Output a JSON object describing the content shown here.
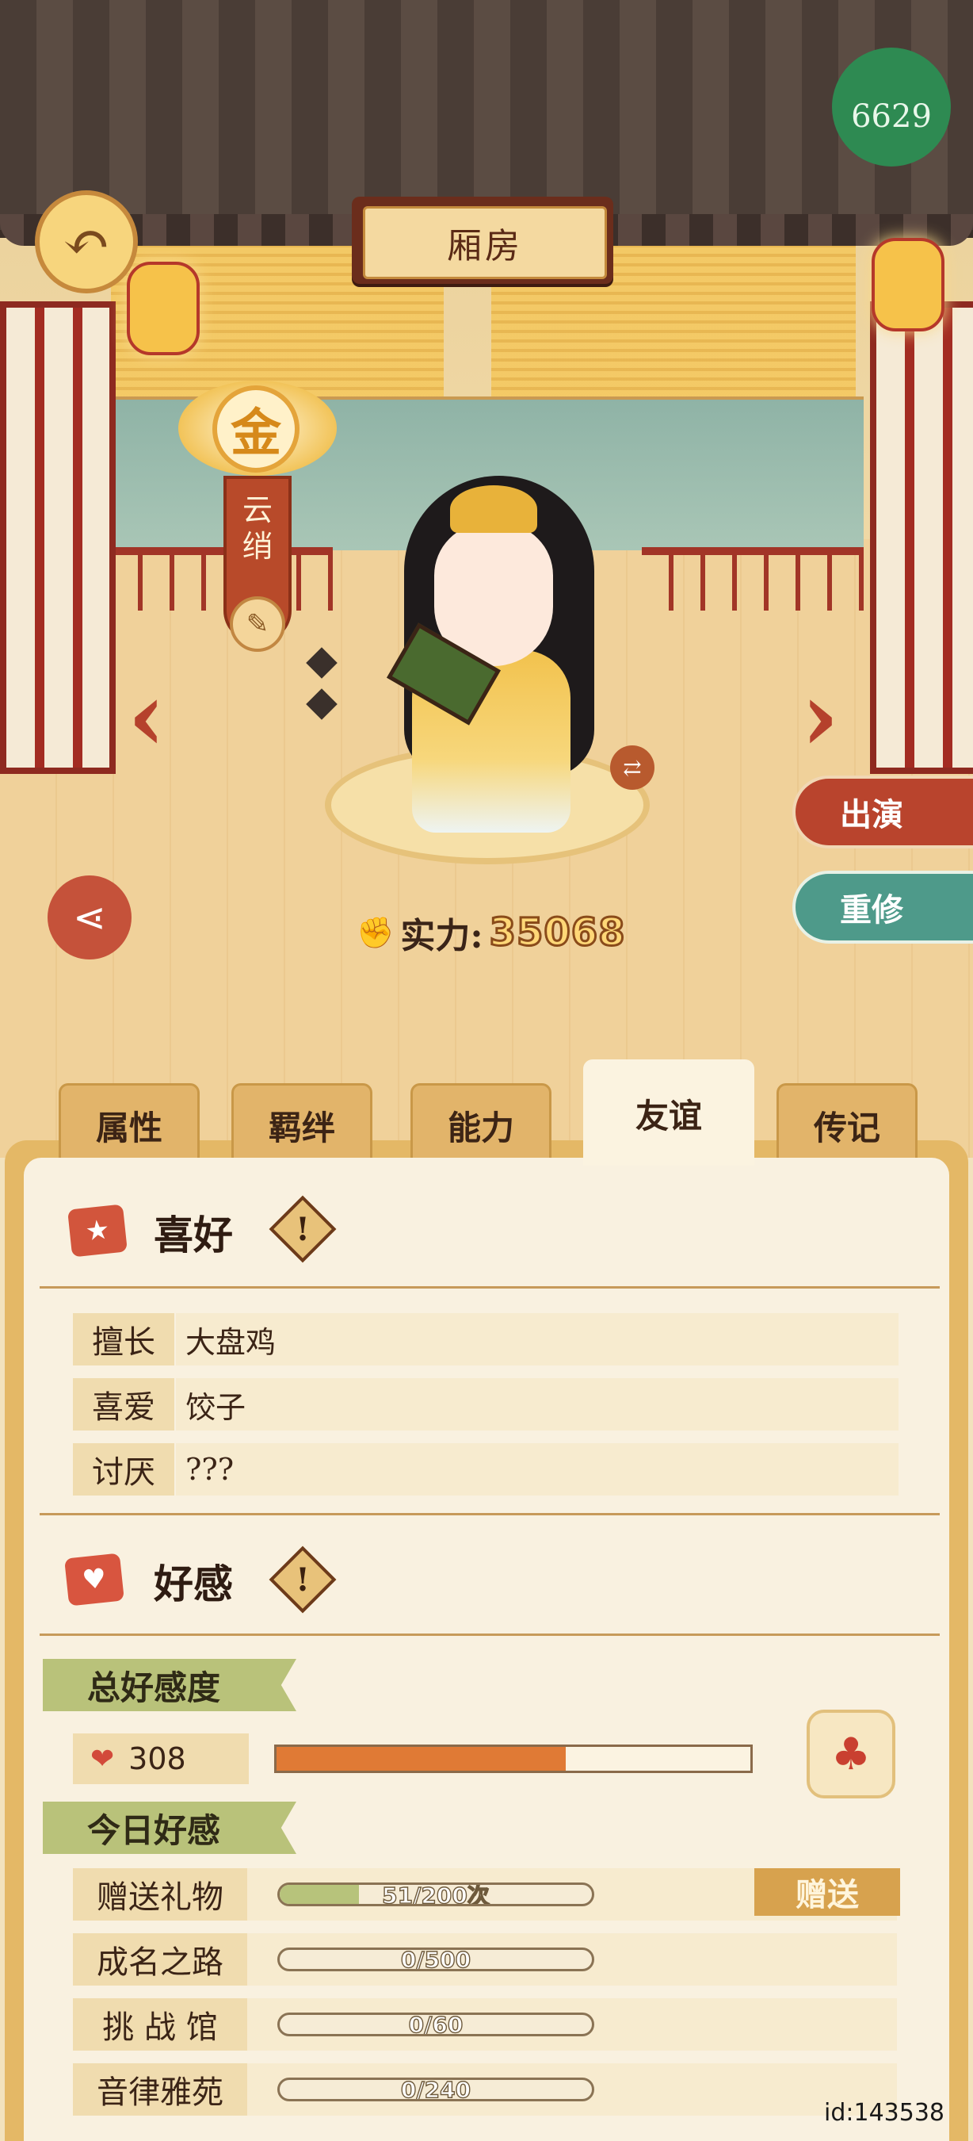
{
  "header": {
    "title": "厢房",
    "corner_badge_text": "6629"
  },
  "character": {
    "grade": "金",
    "name_chars": [
      "云",
      "绡"
    ],
    "power_label": "实力:",
    "power_value": "35068"
  },
  "actions": {
    "perform": "出演",
    "retrain": "重修"
  },
  "tabs": [
    {
      "label": "属性",
      "active": false
    },
    {
      "label": "羁绊",
      "active": false
    },
    {
      "label": "能力",
      "active": false
    },
    {
      "label": "友谊",
      "active": true
    },
    {
      "label": "传记",
      "active": false
    }
  ],
  "preferences": {
    "title": "喜好",
    "info_mark": "!",
    "rows": [
      {
        "label": "擅长",
        "value": "大盘鸡"
      },
      {
        "label": "喜爱",
        "value": "饺子"
      },
      {
        "label": "讨厌",
        "value": "???"
      }
    ]
  },
  "affection": {
    "title": "好感",
    "info_mark": "!",
    "total_label": "总好感度",
    "total_value": "308",
    "total_progress": 0.61,
    "today_label": "今日好感",
    "today_rows": [
      {
        "label": "赠送礼物",
        "text": "51/200次",
        "progress": 0.255
      },
      {
        "label": "成名之路",
        "text": "0/500",
        "progress": 0
      },
      {
        "label": "挑 战 馆",
        "text": "0/60",
        "progress": 0
      },
      {
        "label": "音律雅苑",
        "text": "0/240",
        "progress": 0
      }
    ],
    "gift_button": "赠送"
  },
  "footer": {
    "id_text": "id:143538"
  },
  "colors": {
    "accent_red": "#b9442d",
    "accent_teal": "#4e9a8a",
    "progress_orange": "#e07a35",
    "progress_green": "#b7c37b"
  }
}
